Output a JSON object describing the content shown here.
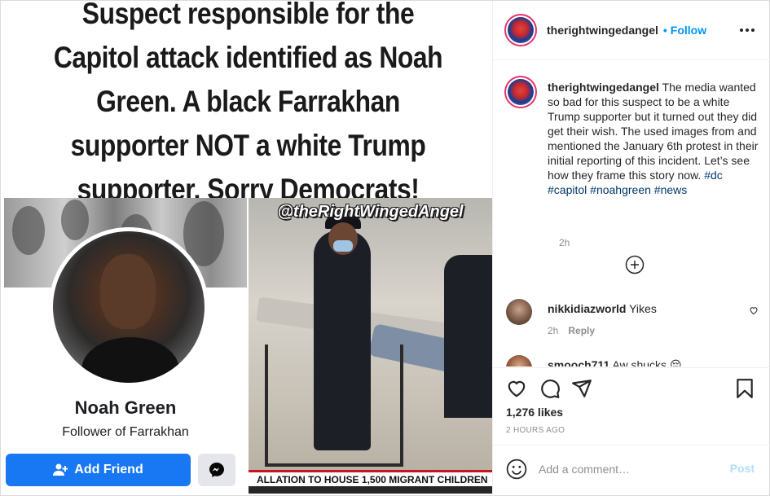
{
  "media": {
    "headline": "Suspect responsible for the Capitol attack identified as Noah Green. A black Farrakhan supporter NOT a white Trump supporter. Sorry Democrats!",
    "facebook_card": {
      "name": "Noah Green",
      "subtitle": "Follower of Farrakhan",
      "add_friend_label": "Add Friend",
      "messenger_icon": "messenger-icon",
      "accent_color": "#1877f2"
    },
    "news_image": {
      "watermark": "@theRightWingedAngel",
      "ticker": "ALLATION TO HOUSE 1,500 MIGRANT CHILDREN"
    }
  },
  "header": {
    "username": "therightwingedangel",
    "separator": "•",
    "follow_label": "Follow",
    "more_icon": "more-options-icon",
    "accent_color": "#0095f6"
  },
  "caption": {
    "username": "therightwingedangel",
    "text": "The media wanted so bad for this suspect to be a white Trump supporter but it turned out they did get their wish. The used images from and mentioned the January 6th protest in their initial reporting of this incident. Let’s see how they frame this story now.",
    "hashtags": [
      "#dc",
      "#capitol",
      "#noahgreen",
      "#news"
    ],
    "time": "2h",
    "load_more_icon": "plus-circle-icon"
  },
  "comments": [
    {
      "username": "nikkidiazworld",
      "text": "Yikes",
      "time": "2h",
      "reply_label": "Reply",
      "like_icon": "heart-icon"
    },
    {
      "username": "smooch711",
      "text": "Aw shucks 😔"
    }
  ],
  "actions": {
    "icons": [
      "heart-icon",
      "comment-icon",
      "share-icon",
      "bookmark-icon"
    ],
    "likes": "1,276 likes",
    "posted": "2 HOURS AGO"
  },
  "comment_box": {
    "emoji_icon": "emoji-icon",
    "placeholder": "Add a comment…",
    "post_label": "Post",
    "post_color": "#b2dffc"
  }
}
